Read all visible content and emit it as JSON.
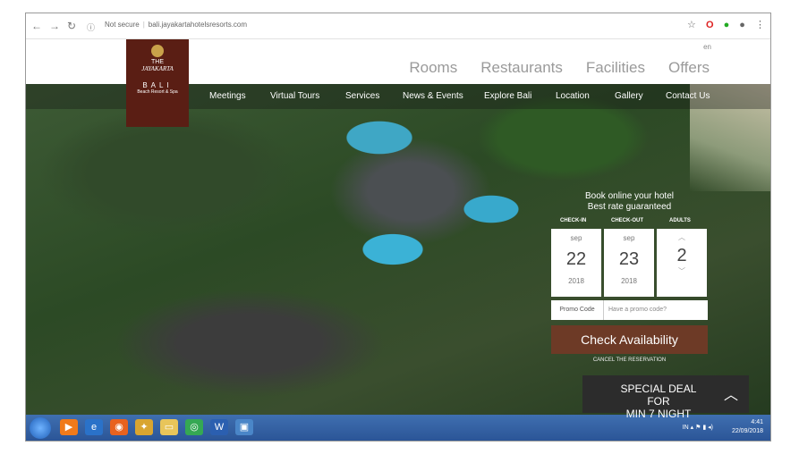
{
  "browser": {
    "security": "Not secure",
    "url": "bali.jayakartahotelsresorts.com",
    "back_icon": "back-arrow-icon",
    "forward_icon": "forward-arrow-icon",
    "reload_icon": "reload-icon"
  },
  "header": {
    "lang": "en",
    "main_nav": [
      "Rooms",
      "Restaurants",
      "Facilities",
      "Offers"
    ],
    "logo": {
      "line1": "THE",
      "line2": "JAYAKARTA",
      "line3": "BALI",
      "line4": "Beach Resort & Spa"
    }
  },
  "subnav": [
    "Meetings",
    "Virtual Tours",
    "Services",
    "News & Events",
    "Explore Bali",
    "Location",
    "Gallery",
    "Contact Us"
  ],
  "booking": {
    "line1": "Book online your hotel",
    "line2": "Best rate guaranteed",
    "checkin_label": "CHECK-IN",
    "checkout_label": "CHECK-OUT",
    "adults_label": "ADULTS",
    "checkin": {
      "month": "sep",
      "day": "22",
      "year": "2018"
    },
    "checkout": {
      "month": "sep",
      "day": "23",
      "year": "2018"
    },
    "adults": "2",
    "promo_label": "Promo Code",
    "promo_placeholder": "Have a promo code?",
    "check_label": "Check Availability",
    "cancel_label": "CANCEL THE RESERVATION"
  },
  "deal": {
    "line1": "SPECIAL DEAL FOR",
    "line2": "MIN 7 NIGHT"
  },
  "taskbar": {
    "lang": "IN",
    "time": "4:41",
    "date": "22/09/2018"
  },
  "colors": {
    "brand": "#5a1e14",
    "check_button": "#6d3a26",
    "deal_bg": "#2c2c2c",
    "taskbar": "#2b5597"
  }
}
